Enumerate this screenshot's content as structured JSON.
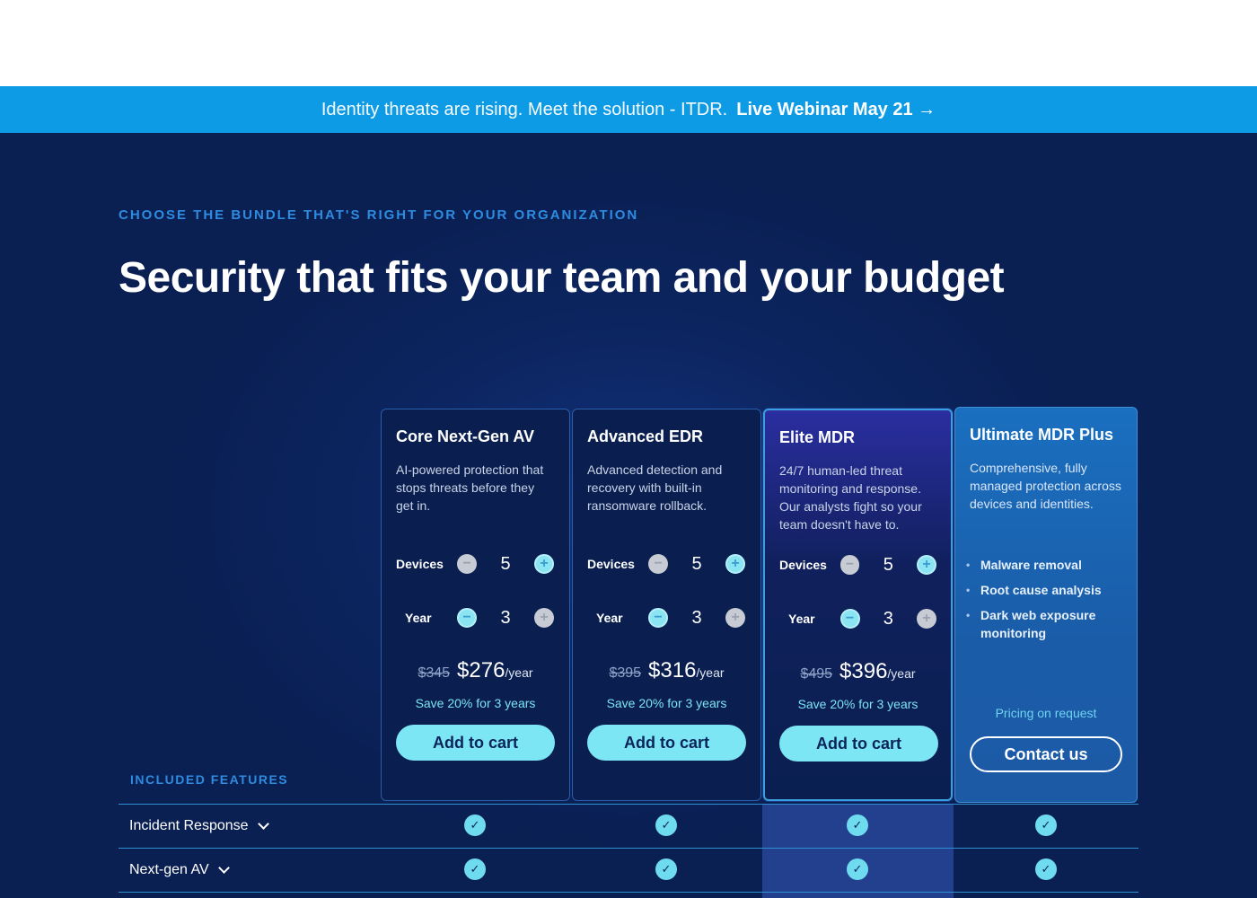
{
  "banner": {
    "message": "Identity threats are rising. Meet the solution - ITDR.",
    "link": "Live Webinar May 21 →"
  },
  "hero": {
    "eyebrow": "CHOOSE THE BUNDLE THAT'S RIGHT FOR YOUR ORGANIZATION",
    "title": "Security that fits your team and your budget"
  },
  "plans": [
    {
      "title": "Core Next-Gen AV",
      "desc": "AI-powered protection that stops threats before they get in.",
      "devices_label": "Devices",
      "devices": "5",
      "year_label": "Year",
      "year": "3",
      "old_price": "$345",
      "price": "$276",
      "per": "/year",
      "save": "Save 20% for 3 years",
      "cta": "Add to cart"
    },
    {
      "title": "Advanced EDR",
      "desc": "Advanced detection and recovery with built-in ransomware rollback.",
      "devices_label": "Devices",
      "devices": "5",
      "year_label": "Year",
      "year": "3",
      "old_price": "$395",
      "price": "$316",
      "per": "/year",
      "save": "Save 20% for 3 years",
      "cta": "Add to cart"
    },
    {
      "title": "Elite MDR",
      "desc": "24/7 human-led threat monitoring and response. Our analysts fight so your team doesn't have to.",
      "devices_label": "Devices",
      "devices": "5",
      "year_label": "Year",
      "year": "3",
      "old_price": "$495",
      "price": "$396",
      "per": "/year",
      "save": "Save 20% for 3 years",
      "cta": "Add to cart"
    },
    {
      "title": "Ultimate MDR Plus",
      "desc": "Comprehensive, fully managed protection across devices and identities.",
      "bullets": [
        "Malware removal",
        "Root cause analysis",
        "Dark web exposure monitoring"
      ],
      "pricing": "Pricing on request",
      "cta": "Contact us"
    }
  ],
  "features": {
    "label": "INCLUDED FEATURES",
    "rows": [
      {
        "name": "Incident Response",
        "check": "✓"
      },
      {
        "name": "Next-gen AV",
        "check": "✓"
      }
    ]
  },
  "icons": {
    "minus": "−",
    "plus": "+"
  },
  "colors": {
    "banner": "#0d9be6",
    "background": "#0a1f52",
    "accent": "#7de6f5",
    "eyebrow": "#2f8be0"
  }
}
